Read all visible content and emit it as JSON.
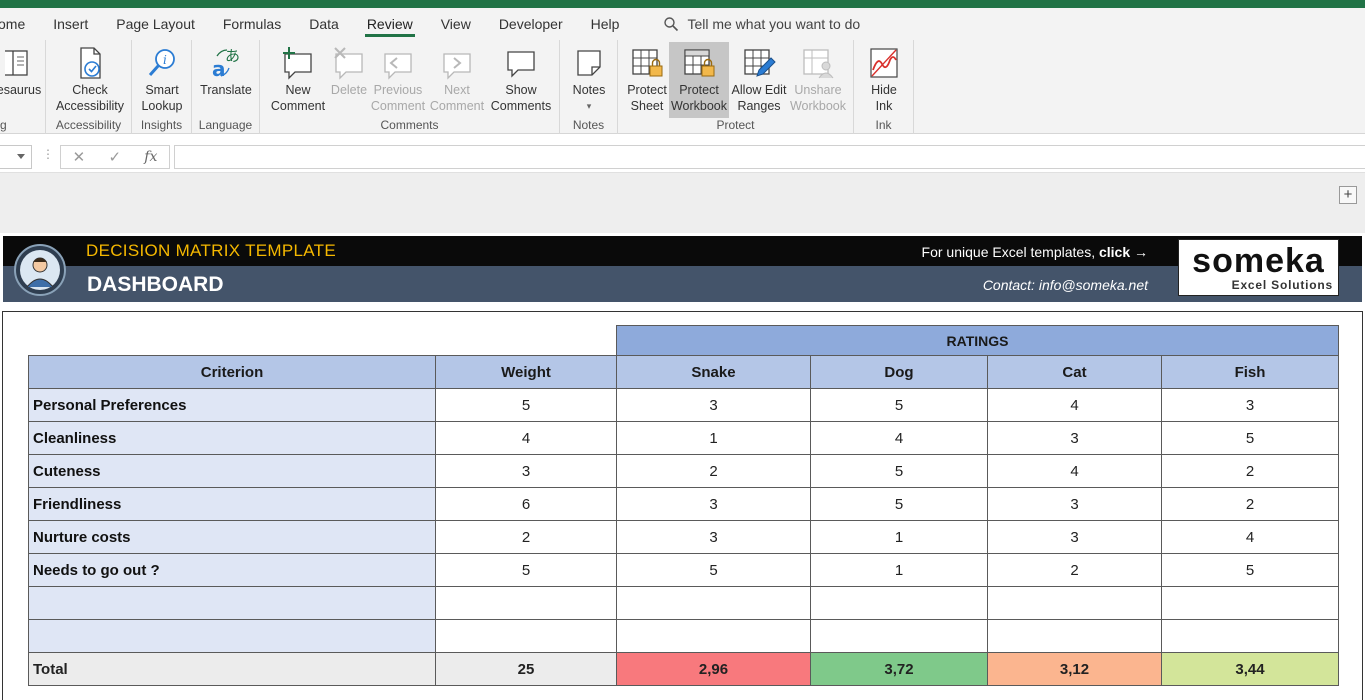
{
  "menu": {
    "tabs": [
      "ome",
      "Insert",
      "Page Layout",
      "Formulas",
      "Data",
      "Review",
      "View",
      "Developer",
      "Help"
    ],
    "active_tab": "Review",
    "tell_me": "Tell me what you want to do"
  },
  "ribbon": {
    "thesaurus": "esaurus",
    "group_proofing_tail": "g",
    "check_accessibility_1": "Check",
    "check_accessibility_2": "Accessibility",
    "group_accessibility": "Accessibility",
    "smart_lookup_1": "Smart",
    "smart_lookup_2": "Lookup",
    "group_insights": "Insights",
    "translate": "Translate",
    "group_language": "Language",
    "new_comment_1": "New",
    "new_comment_2": "Comment",
    "delete": "Delete",
    "previous_comment_1": "Previous",
    "previous_comment_2": "Comment",
    "next_comment_1": "Next",
    "next_comment_2": "Comment",
    "show_comments_1": "Show",
    "show_comments_2": "Comments",
    "group_comments": "Comments",
    "notes": "Notes",
    "group_notes": "Notes",
    "protect_sheet_1": "Protect",
    "protect_sheet_2": "Sheet",
    "protect_workbook_1": "Protect",
    "protect_workbook_2": "Workbook",
    "allow_edit_1": "Allow Edit",
    "allow_edit_2": "Ranges",
    "unshare_1": "Unshare",
    "unshare_2": "Workbook",
    "group_protect": "Protect",
    "hide_ink_1": "Hide",
    "hide_ink_2": "Ink",
    "group_ink": "Ink"
  },
  "formula_bar": {
    "fx": "fx",
    "cancel": "✕",
    "enter": "✓",
    "value": ""
  },
  "dashboard": {
    "title": "DECISION MATRIX TEMPLATE",
    "subtitle": "DASHBOARD",
    "promo_text": "For unique Excel templates, ",
    "promo_click": "click",
    "promo_arrow": "→",
    "contact": "Contact: info@someka.net",
    "brand_name": "someka",
    "brand_tag": "Excel Solutions"
  },
  "matrix": {
    "ratings_label": "RATINGS",
    "headers": {
      "criterion": "Criterion",
      "weight": "Weight",
      "options": [
        "Snake",
        "Dog",
        "Cat",
        "Fish"
      ]
    },
    "rows": [
      {
        "criterion": "Personal Preferences",
        "weight": "5",
        "ratings": [
          "3",
          "5",
          "4",
          "3"
        ]
      },
      {
        "criterion": "Cleanliness",
        "weight": "4",
        "ratings": [
          "1",
          "4",
          "3",
          "5"
        ]
      },
      {
        "criterion": "Cuteness",
        "weight": "3",
        "ratings": [
          "2",
          "5",
          "4",
          "2"
        ]
      },
      {
        "criterion": "Friendliness",
        "weight": "6",
        "ratings": [
          "3",
          "5",
          "3",
          "2"
        ]
      },
      {
        "criterion": "Nurture costs",
        "weight": "2",
        "ratings": [
          "3",
          "1",
          "3",
          "4"
        ]
      },
      {
        "criterion": "Needs to go out ?",
        "weight": "5",
        "ratings": [
          "5",
          "1",
          "2",
          "5"
        ]
      },
      {
        "criterion": "",
        "weight": "",
        "ratings": [
          "",
          "",
          "",
          ""
        ]
      },
      {
        "criterion": "",
        "weight": "",
        "ratings": [
          "",
          "",
          "",
          ""
        ]
      }
    ],
    "total": {
      "label": "Total",
      "weight": "25",
      "scores": [
        "2,96",
        "3,72",
        "3,12",
        "3,44"
      ],
      "score_colors": [
        "#f8797d",
        "#7fc98a",
        "#fbb58f",
        "#d3e59a"
      ]
    }
  },
  "colors": {
    "excel_green": "#217346",
    "header_dark": "#0a0a0a",
    "header_slate": "#44546a",
    "title_gold": "#f5b800",
    "ratings_blue": "#8eaadb",
    "header_blue": "#b4c6e7",
    "criterion_bg": "#dfe6f5"
  }
}
